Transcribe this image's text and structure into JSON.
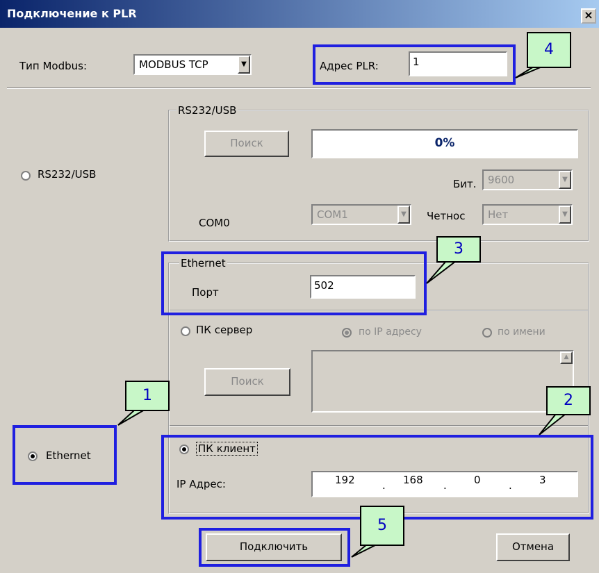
{
  "window": {
    "title": "Подключение к PLR",
    "close_glyph": "×"
  },
  "top_bar": {
    "modbus_type_label": "Тип Modbus:",
    "modbus_type_value": "MODBUS TCP",
    "plr_address_label": "Адрес PLR:",
    "plr_address_value": "1"
  },
  "rs232": {
    "radio_label": "RS232/USB",
    "group_title": "RS232/USB",
    "search_button": "Поиск",
    "progress_text": "0%",
    "progress": 0,
    "baud_label": "Бит.",
    "baud_value": "9600",
    "com_label": "COM0",
    "com_value": "COM1",
    "parity_label": "Четнос",
    "parity_value": "Нет"
  },
  "ethernet": {
    "radio_label": "Ethernet",
    "group_title": "Ethernet",
    "port_label": "Порт",
    "port_value": "502",
    "pc_server_label": "ПК сервер",
    "by_ip_label": "по IP адресу",
    "by_name_label": "по имени",
    "search_button": "Поиск",
    "pc_client_label": "ПК клиент",
    "ip_label": "IP Адрес:",
    "ip_octets": [
      "192",
      "168",
      "0",
      "3"
    ],
    "ip_dot": "."
  },
  "footer": {
    "connect_button": "Подключить",
    "cancel_button": "Отмена"
  },
  "annotations": [
    "1",
    "2",
    "3",
    "4",
    "5"
  ],
  "colors": {
    "highlight": "#1f1fe0",
    "badge_fill": "#c8f7c8",
    "titlebar": "#0a246a",
    "dialog": "#d4d0c8"
  }
}
